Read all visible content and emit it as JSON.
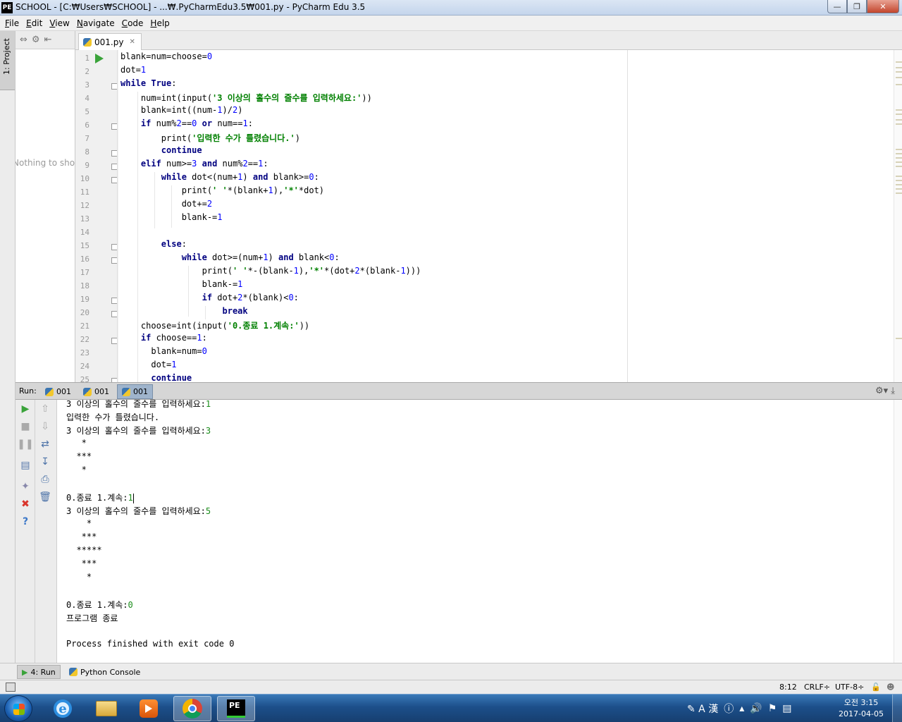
{
  "window": {
    "title": "SCHOOL - [C:₩Users₩SCHOOL] - ...₩.PyCharmEdu3.5₩001.py - PyCharm Edu 3.5",
    "app_icon": "PE",
    "ghost_tab_1": "",
    "ghost_tab_2": ""
  },
  "menu": [
    {
      "label": "File",
      "key": "F"
    },
    {
      "label": "Edit",
      "key": "E"
    },
    {
      "label": "View",
      "key": "V"
    },
    {
      "label": "Navigate",
      "key": "N"
    },
    {
      "label": "Code",
      "key": "C"
    },
    {
      "label": "Help",
      "key": "H"
    }
  ],
  "project_panel": {
    "tab_label": "1: Project",
    "empty_text": "Nothing to show"
  },
  "editor": {
    "tab_label": "001.py",
    "line_numbers": [
      "1",
      "2",
      "3",
      "4",
      "5",
      "6",
      "7",
      "8",
      "9",
      "10",
      "11",
      "12",
      "13",
      "14",
      "15",
      "16",
      "17",
      "18",
      "19",
      "20",
      "21",
      "22",
      "23",
      "24",
      "25"
    ]
  },
  "run_panel": {
    "label": "Run:",
    "tabs": [
      "001",
      "001",
      "001"
    ],
    "active_tab": 2
  },
  "console": {
    "lines": [
      {
        "t": "3 이상의 홀수의 줄수를 입력하세요:",
        "in": "1"
      },
      {
        "t": "입력한 수가 틀렸습니다.",
        "in": ""
      },
      {
        "t": "3 이상의 홀수의 줄수를 입력하세요:",
        "in": "3"
      },
      {
        "t": "   *",
        "in": ""
      },
      {
        "t": "  ***",
        "in": ""
      },
      {
        "t": "   *",
        "in": ""
      },
      {
        "t": "",
        "in": ""
      },
      {
        "t": "0.종료 1.계속:",
        "in": "1"
      },
      {
        "t": "3 이상의 홀수의 줄수를 입력하세요:",
        "in": "5"
      },
      {
        "t": "    *",
        "in": ""
      },
      {
        "t": "   ***",
        "in": ""
      },
      {
        "t": "  *****",
        "in": ""
      },
      {
        "t": "   ***",
        "in": ""
      },
      {
        "t": "    *",
        "in": ""
      },
      {
        "t": "",
        "in": ""
      },
      {
        "t": "0.종료 1.계속:",
        "in": "0"
      },
      {
        "t": "프로그램 종료",
        "in": ""
      },
      {
        "t": "",
        "in": ""
      },
      {
        "t": "Process finished with exit code 0",
        "in": ""
      }
    ]
  },
  "tool_tabs": {
    "run": "4: Run",
    "console": "Python Console"
  },
  "status": {
    "position": "8:12",
    "line_sep": "CRLF÷",
    "encoding": "UTF-8÷"
  },
  "clock": {
    "time": "오전 3:15",
    "date": "2017-04-05"
  },
  "colors": {
    "keyword": "#000080",
    "string": "#008000",
    "number": "#0000ff",
    "console_input": "#1a8c1a"
  }
}
